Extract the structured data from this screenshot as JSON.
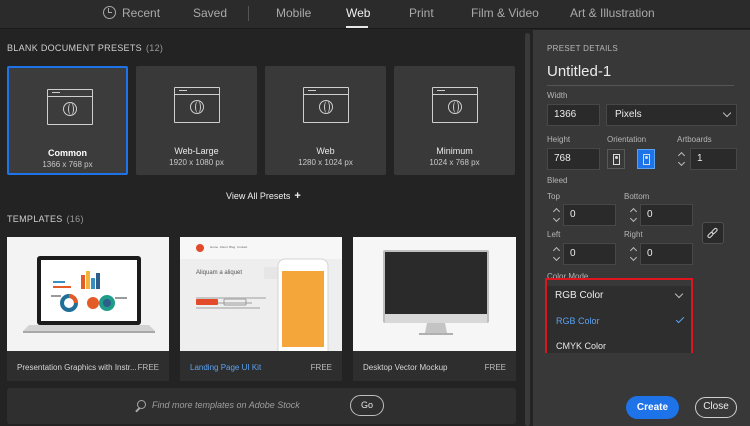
{
  "tabs": [
    {
      "label": "Recent"
    },
    {
      "label": "Saved"
    },
    {
      "label": "Mobile"
    },
    {
      "label": "Web",
      "active": true
    },
    {
      "label": "Print"
    },
    {
      "label": "Film & Video"
    },
    {
      "label": "Art & Illustration"
    }
  ],
  "blank_presets": {
    "title": "BLANK DOCUMENT PRESETS",
    "count": "(12)",
    "items": [
      {
        "name": "Common",
        "size": "1366 x 768 px",
        "selected": true
      },
      {
        "name": "Web-Large",
        "size": "1920 x 1080 px"
      },
      {
        "name": "Web",
        "size": "1280 x 1024 px"
      },
      {
        "name": "Minimum",
        "size": "1024 x 768 px"
      }
    ],
    "view_all": "View All Presets",
    "view_all_icon": "+"
  },
  "templates": {
    "title": "TEMPLATES",
    "count": "(16)",
    "items": [
      {
        "name": "Presentation Graphics with Instr...",
        "badge": "FREE"
      },
      {
        "name": "Landing Page UI Kit",
        "badge": "FREE",
        "highlight": true
      },
      {
        "name": "Desktop Vector Mockup",
        "badge": "FREE"
      }
    ],
    "landing_headline": "Aliquam a aliquet",
    "landing_nav": [
      "Home",
      "About",
      "Blog",
      "Contact"
    ]
  },
  "stock": {
    "placeholder": "Find more templates on Adobe Stock",
    "go_label": "Go"
  },
  "details": {
    "title": "PRESET DETAILS",
    "doc_name": "Untitled-1",
    "width_label": "Width",
    "width_value": "1366",
    "unit": "Pixels",
    "height_label": "Height",
    "height_value": "768",
    "orientation_label": "Orientation",
    "artboards_label": "Artboards",
    "artboards_value": "1",
    "bleed_label": "Bleed",
    "top_label": "Top",
    "top_value": "0",
    "bottom_label": "Bottom",
    "bottom_value": "0",
    "left_label": "Left",
    "left_value": "0",
    "right_label": "Right",
    "right_value": "0",
    "color_mode_label": "Color Mode",
    "color_mode_value": "RGB Color",
    "color_mode_options": [
      "RGB Color",
      "CMYK Color"
    ],
    "create_label": "Create",
    "close_label": "Close"
  },
  "colors": {
    "accent": "#1e73e8",
    "highlight_box": "#e0141e",
    "link_blue": "#5aa2f0"
  }
}
